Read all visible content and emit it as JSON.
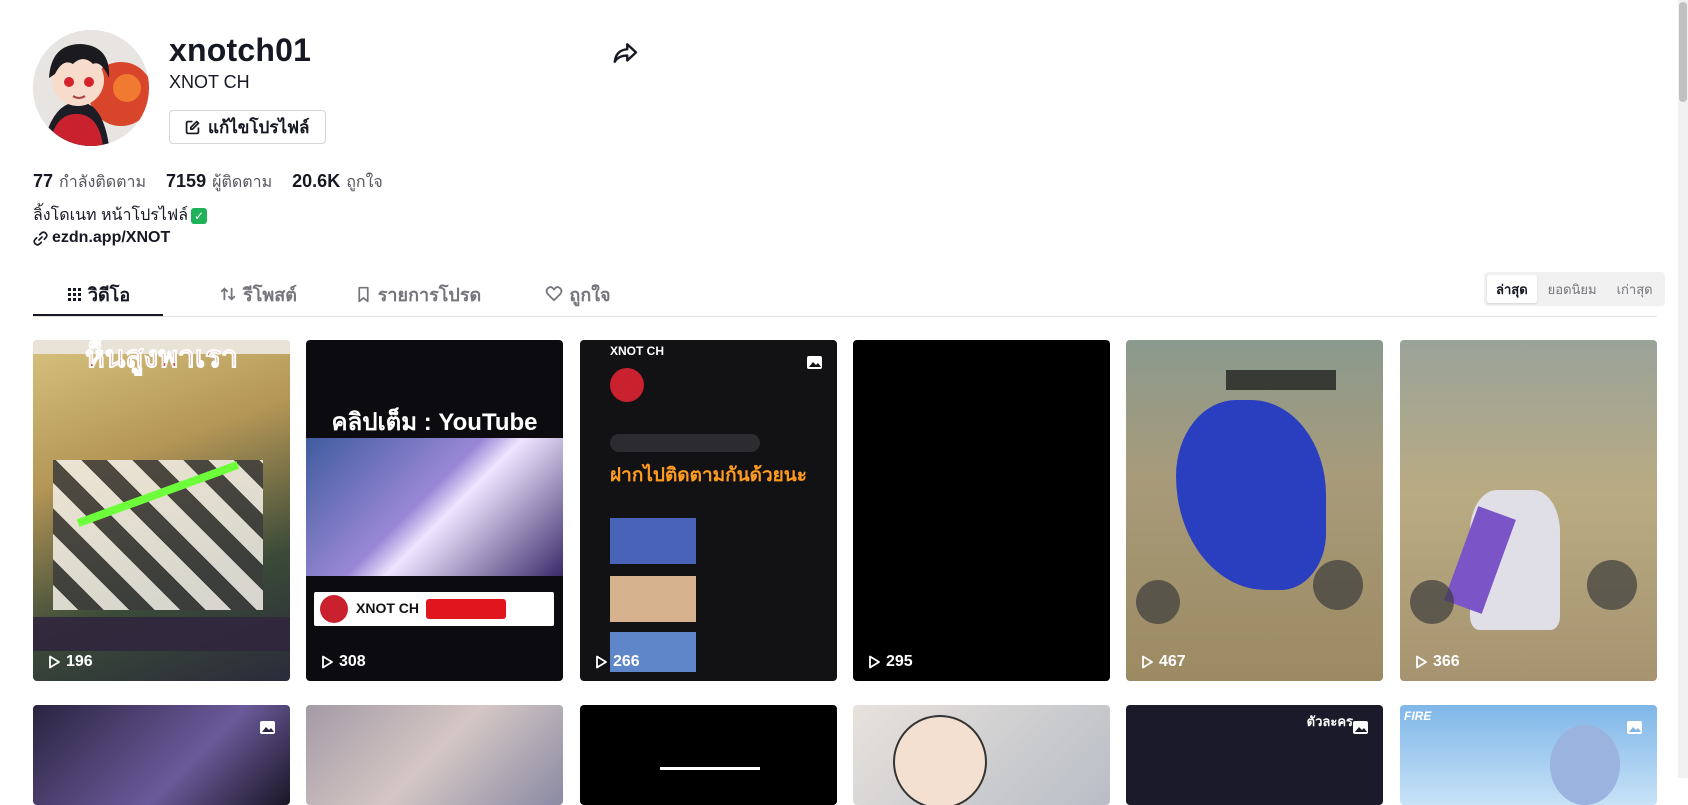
{
  "profile": {
    "username": "xnotch01",
    "nickname": "XNOT CH",
    "edit_button_label": "แก้ไขโปรไฟล์",
    "stats": [
      {
        "value": "77",
        "label": "กำลังติดตาม"
      },
      {
        "value": "7159",
        "label": "ผู้ติดตาม"
      },
      {
        "value": "20.6K",
        "label": "ถูกใจ"
      }
    ],
    "bio": "ลิ้งโดเนท หน้าโปรไฟล์",
    "link": "ezdn.app/XNOT"
  },
  "tabs": [
    {
      "label": "วิดีโอ",
      "icon": "grid-icon",
      "active": true
    },
    {
      "label": "รีโพสต์",
      "icon": "repost-icon",
      "active": false
    },
    {
      "label": "รายการโปรด",
      "icon": "bookmark-icon",
      "active": false
    },
    {
      "label": "ถูกใจ",
      "icon": "heart-icon",
      "active": false
    }
  ],
  "sort": {
    "options": [
      "ล่าสุด",
      "ยอดนิยม",
      "เก่าสุด"
    ],
    "selected": "ล่าสุด"
  },
  "videos": [
    {
      "views": "196",
      "overlay": "ห็นสูงพาเรา"
    },
    {
      "views": "308",
      "overlay": "คลิปเต็ม : YouTube",
      "footer": "XNOT CH"
    },
    {
      "views": "266",
      "overlay": "ฝากไปติดตามกันด้วยนะ",
      "header": "XNOT CH"
    },
    {
      "views": "295",
      "overlay": ""
    },
    {
      "views": "467",
      "overlay": ""
    },
    {
      "views": "366",
      "overlay": ""
    }
  ],
  "row2_overlays": [
    "",
    "",
    "",
    "",
    "ตัวละคร",
    "FIRE"
  ],
  "colors": {
    "accent": "#161823",
    "verified": "#1fb25a",
    "subscribe_red": "#e0151d"
  }
}
